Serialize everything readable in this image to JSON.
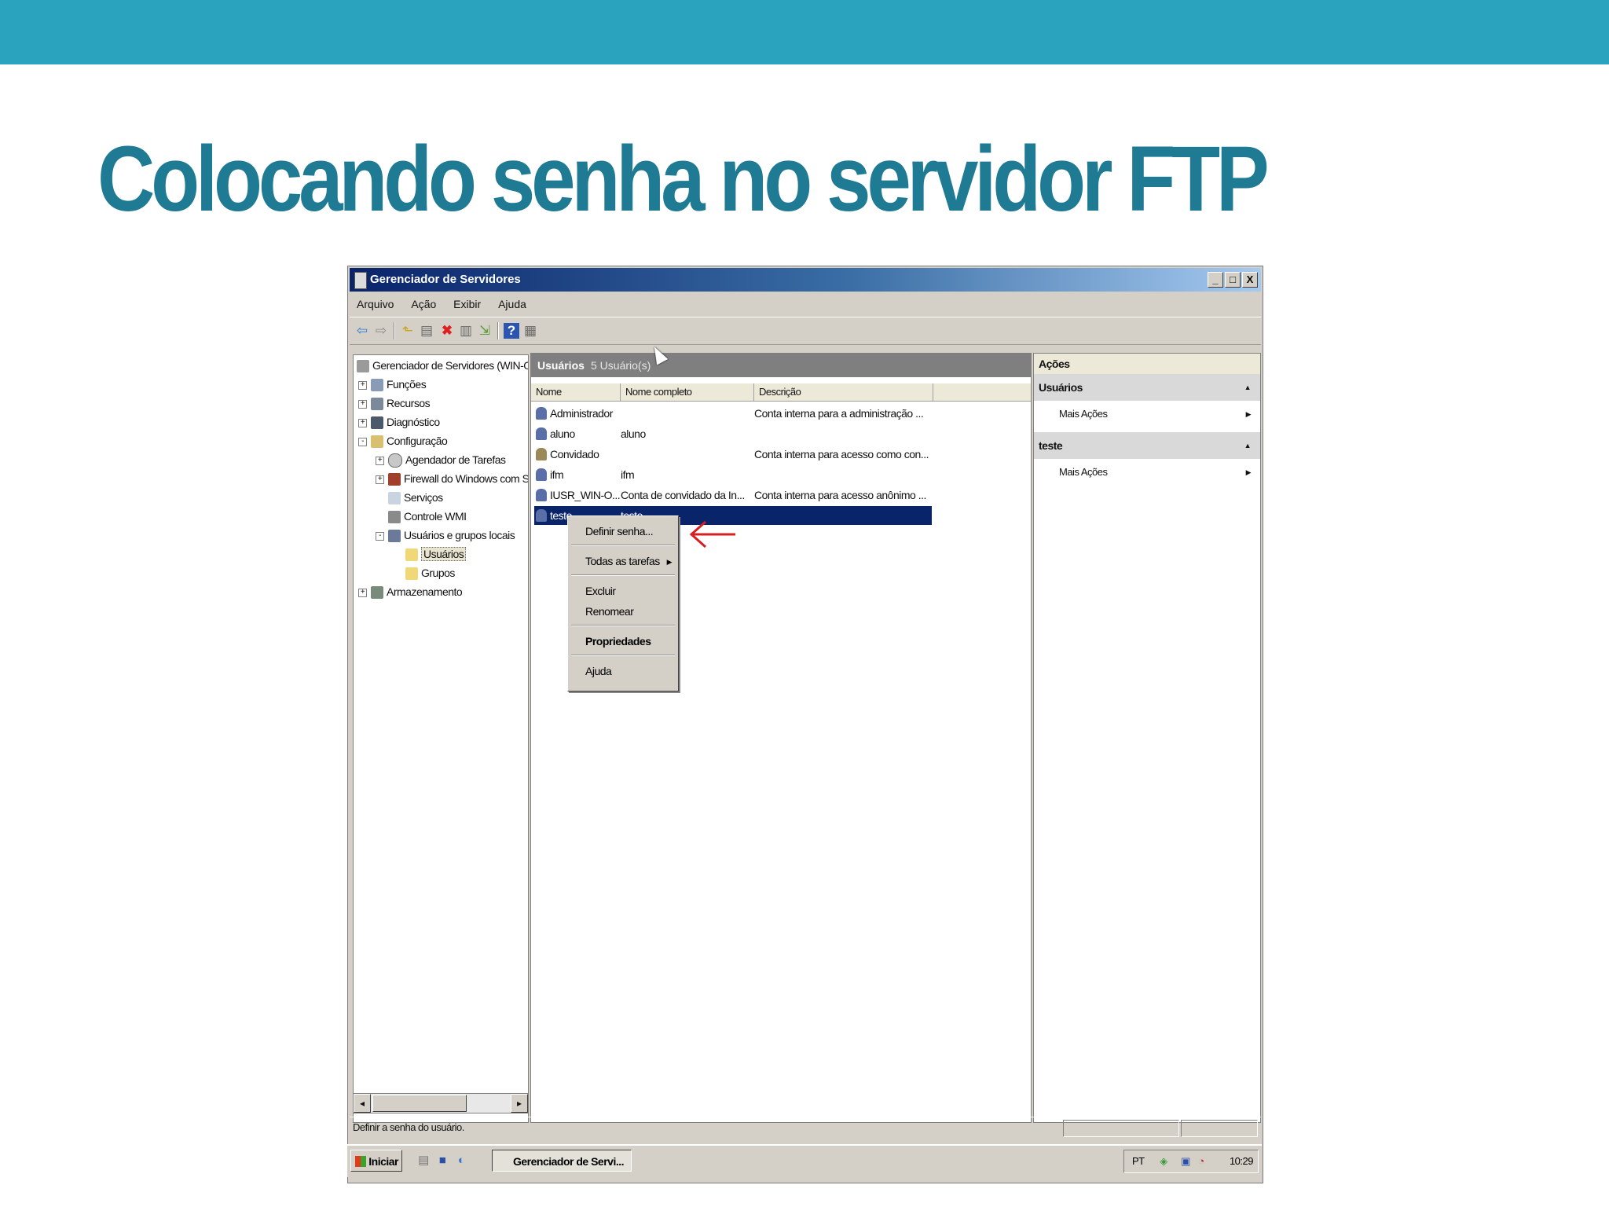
{
  "slide": {
    "title": "Colocando senha no servidor FTP",
    "accent_color": "#2aa3bf",
    "title_color": "#1f7a93"
  },
  "window": {
    "title": "Gerenciador de Servidores",
    "controls": [
      "_",
      "□",
      "X"
    ],
    "menu": [
      "Arquivo",
      "Ação",
      "Exibir",
      "Ajuda"
    ]
  },
  "toolbar": {
    "icons": [
      "back-icon",
      "forward-icon",
      "up-icon",
      "show-hide-tree-icon",
      "delete-icon",
      "properties-icon",
      "export-icon",
      "help-icon",
      "view-icon"
    ]
  },
  "tree": {
    "root": "Gerenciador de Servidores (WIN-O",
    "items": [
      {
        "label": "Funções",
        "expander": "+"
      },
      {
        "label": "Recursos",
        "expander": "+"
      },
      {
        "label": "Diagnóstico",
        "expander": "+"
      },
      {
        "label": "Configuração",
        "expander": "-"
      },
      {
        "label": "Agendador de Tarefas",
        "expander": "+"
      },
      {
        "label": "Firewall do Windows com Se",
        "expander": "+"
      },
      {
        "label": "Serviços",
        "expander": ""
      },
      {
        "label": "Controle WMI",
        "expander": ""
      },
      {
        "label": "Usuários e grupos locais",
        "expander": "-"
      },
      {
        "label": "Usuários",
        "expander": ""
      },
      {
        "label": "Grupos",
        "expander": ""
      },
      {
        "label": "Armazenamento",
        "expander": "+"
      }
    ]
  },
  "center": {
    "header_title": "Usuários",
    "header_count": "5 Usuário(s)",
    "columns": [
      "Nome",
      "Nome completo",
      "Descrição"
    ],
    "rows": [
      {
        "name": "Administrador",
        "full_name": "",
        "description": "Conta interna para a administração ..."
      },
      {
        "name": "aluno",
        "full_name": "aluno",
        "description": ""
      },
      {
        "name": "Convidado",
        "full_name": "",
        "description": "Conta interna para acesso como con..."
      },
      {
        "name": "ifm",
        "full_name": "ifm",
        "description": ""
      },
      {
        "name": "IUSR_WIN-O...",
        "full_name": "Conta de convidado da In...",
        "description": "Conta interna para acesso anônimo ..."
      },
      {
        "name": "teste",
        "full_name": "teste",
        "description": ""
      }
    ],
    "selected_row": "teste"
  },
  "context_menu": {
    "items": [
      "Definir senha...",
      "Todas as tarefas",
      "Excluir",
      "Renomear",
      "Propriedades",
      "Ajuda"
    ]
  },
  "actions": {
    "header": "Ações",
    "groups": [
      {
        "title": "Usuários",
        "item": "Mais Ações"
      },
      {
        "title": "teste",
        "item": "Mais Ações"
      }
    ]
  },
  "status": {
    "text": "Definir a senha do usuário."
  },
  "taskbar": {
    "start_label": "Iniciar",
    "task_label": "Gerenciador de Servi...",
    "lang": "PT",
    "clock": "10:29"
  }
}
